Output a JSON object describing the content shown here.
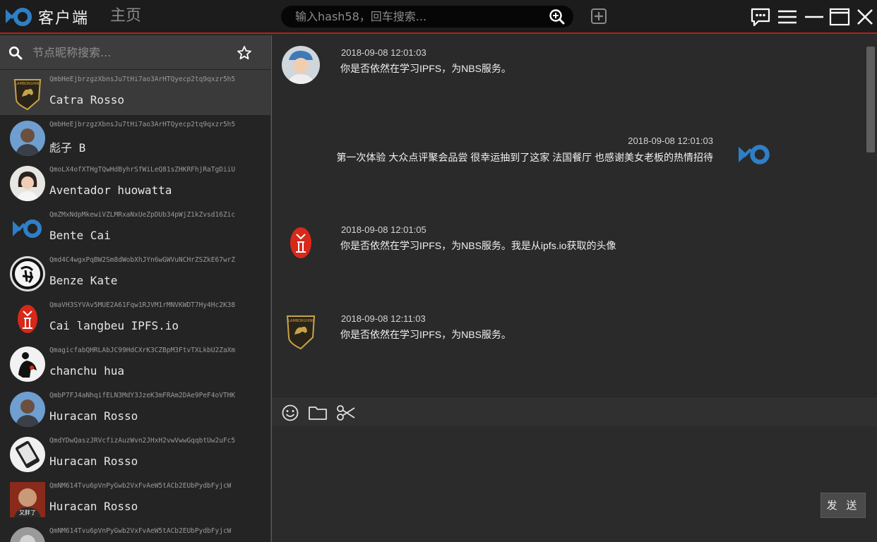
{
  "app": {
    "title": "客户端"
  },
  "nav": {
    "tabs": [
      {
        "label": "主页"
      },
      {
        "label": "聊天",
        "active": true
      }
    ]
  },
  "top_search": {
    "placeholder": "输入hash58，回车搜索..."
  },
  "colors": {
    "accent": "#d8281a",
    "logo_blue": "#2f7fc6",
    "background": "#262626"
  },
  "sidebar": {
    "search_placeholder": "节点昵称搜索...",
    "contacts": [
      {
        "hash": "QmbHeEjbrzgzXbnsJu7tHi7ao3ArHTQyecp2tq9qxzr5h5",
        "name": "Catra Rosso",
        "avatar": "lamborghini-shield",
        "active": true
      },
      {
        "hash": "QmbHeEjbrzgzXbnsJu7tHi7ao3ArHTQyecp2tq9qxzr5h5",
        "name": "彪子 B",
        "avatar": "man-photo"
      },
      {
        "hash": "QmoLX4ofXTHgTQwHdByhrSfWiLeQ81sZHKRFhjRaTgDiiU",
        "name": "Aventador huowatta",
        "avatar": "woman-photo"
      },
      {
        "hash": "QmZMxNdpMkewiVZLMRxaNxUeZpDUb34pWjZ1kZvsd16Zic",
        "name": "Bente Cai",
        "avatar": "app-logo"
      },
      {
        "hash": "Qmd4C4wgxPqBW2Sm8dWobXhJYn6wGWVuNCHrZSZkE67wrZ",
        "name": "Benze Kate",
        "avatar": "calligraphy-seal"
      },
      {
        "hash": "QmaVH3SYVAv5MUE2A61Fqw1RJVM1rMNVKWDT7Hy4Hc2K38",
        "name": "Cai langbeu IPFS.io",
        "avatar": "red-seal"
      },
      {
        "hash": "QmagicfabQHRLAbJC99HdCXrK3CZBpM3FtvTXLkbU2ZaXm",
        "name": "chanchu hua",
        "avatar": "ink-figure"
      },
      {
        "hash": "QmbP7FJ4aNhqifELN3MdY3JzeK3mFRAm2DAe9PeF4oVTHK",
        "name": "Huracan Rosso",
        "avatar": "man-photo"
      },
      {
        "hash": "QmdYDwQaszJRVcfizAuzWvn2JHxH2vwVwwGqqbtUw2uFc5",
        "name": "Huracan Rosso",
        "avatar": "phone-sketch"
      },
      {
        "hash": "QmNM614Tvu6pVnPyGwb2VxFvAeW5tACb2EUbPydbFyjcW",
        "name": "Huracan Rosso",
        "avatar": "bald-man-photo",
        "caption": "又胖了"
      },
      {
        "hash": "QmNM614Tvu6pVnPyGwb2VxFvAeW5tACb2EUbPydbFyjcW",
        "name": "",
        "avatar": "grey-photo"
      }
    ]
  },
  "chat": {
    "messages": [
      {
        "time": "2018-09-08 12:01:03",
        "text": "你是否依然在学习IPFS，为NBS服务。",
        "side": "left",
        "avatar": "woman-cap-photo"
      },
      {
        "time": "2018-09-08 12:01:03",
        "text": "第一次体验 大众点评聚会品尝 很幸运抽到了这家 法国餐厅 也感谢美女老板的热情招待",
        "side": "right",
        "avatar": "app-logo"
      },
      {
        "time": "2018-09-08 12:01:05",
        "text": "你是否依然在学习IPFS，为NBS服务。我是从ipfs.io获取的头像",
        "side": "left",
        "avatar": "red-seal"
      },
      {
        "time": "2018-09-08 12:11:03",
        "text": "你是否依然在学习IPFS，为NBS服务。",
        "side": "left",
        "avatar": "lamborghini-shield"
      }
    ],
    "toolbar": {
      "icons": [
        "smiley-icon",
        "folder-icon",
        "scissors-icon"
      ]
    },
    "send_label": "发 送"
  }
}
